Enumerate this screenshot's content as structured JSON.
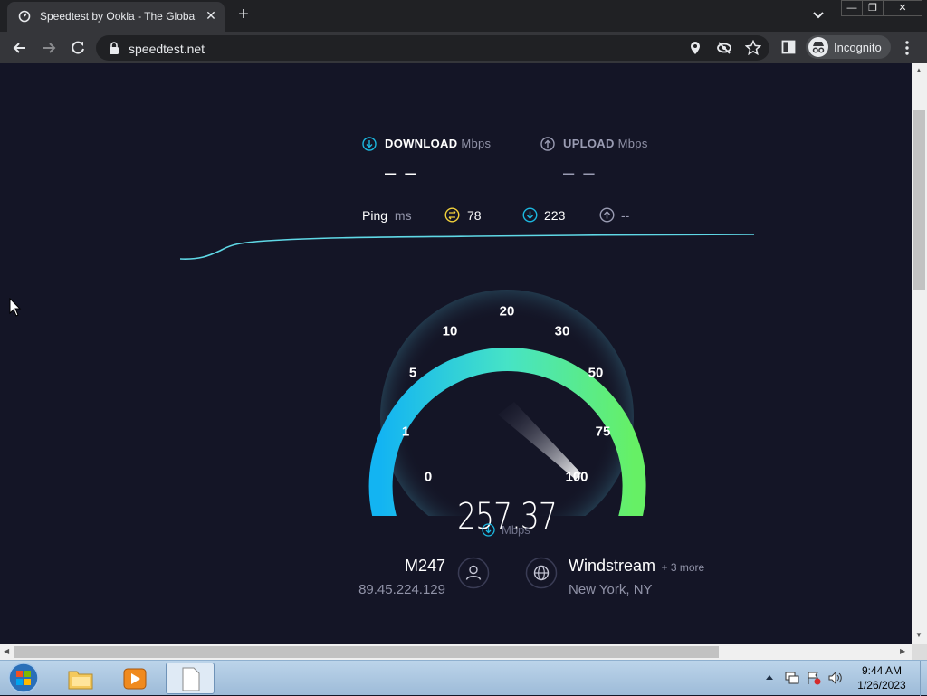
{
  "browser": {
    "tab_title": "Speedtest by Ookla - The Global",
    "url": "speedtest.net",
    "profile_label": "Incognito"
  },
  "speedtest": {
    "download_label": "DOWNLOAD",
    "upload_label": "UPLOAD",
    "unit_mbps": "Mbps",
    "download_value": "– –",
    "upload_value": "– –",
    "ping_label": "Ping",
    "ping_unit": "ms",
    "ping_idle": "78",
    "ping_download": "223",
    "ping_upload": "--",
    "gauge_labels": [
      "0",
      "1",
      "5",
      "10",
      "20",
      "30",
      "50",
      "75",
      "100"
    ],
    "speed_value": "257.37",
    "speed_unit": "Mbps",
    "isp_name": "M247",
    "ip_address": "89.45.224.129",
    "server_name": "Windstream",
    "server_more": "+ 3 more",
    "server_location": "New York, NY"
  },
  "taskbar": {
    "time": "9:44 AM",
    "date": "1/26/2023"
  },
  "colors": {
    "page_bg": "#141526",
    "accent_cyan": "#1cb8e0",
    "accent_green": "#5cf070",
    "upload_purple": "#9a9cb3"
  }
}
